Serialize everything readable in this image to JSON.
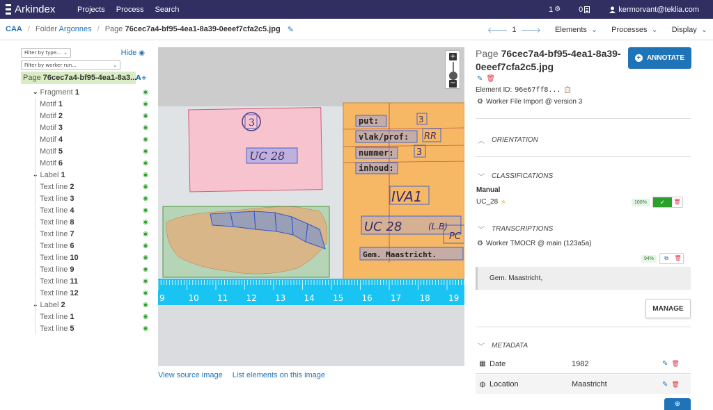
{
  "navbar": {
    "brand": "Arkindex",
    "links": [
      "Projects",
      "Process",
      "Search"
    ],
    "jobs_count": "1",
    "docs_count": "0",
    "user": "kermorvant@teklia.com"
  },
  "breadcrumb": {
    "corpus": "CAA",
    "folder_type": "Folder",
    "folder_name": "Argonnes",
    "page_type": "Page",
    "page_name": "76cec7a4-bf95-4ea1-8a39-0eeef7cfa2c5.jpg",
    "page_number": "1",
    "menus": [
      "Elements",
      "Processes",
      "Display"
    ]
  },
  "sidebar": {
    "filter_type": "Filter by type...",
    "filter_worker": "Filter by worker run...",
    "hide_label": "Hide",
    "add_label": "A+",
    "root_type": "Page",
    "root_name": "76cec7a4-bf95-4ea1-8a3...",
    "tree": [
      {
        "type": "Fragment",
        "name": "1",
        "level": 1,
        "expandable": true
      },
      {
        "type": "Motif",
        "name": "1",
        "level": 2
      },
      {
        "type": "Motif",
        "name": "2",
        "level": 2
      },
      {
        "type": "Motif",
        "name": "3",
        "level": 2
      },
      {
        "type": "Motif",
        "name": "4",
        "level": 2
      },
      {
        "type": "Motif",
        "name": "5",
        "level": 2
      },
      {
        "type": "Motif",
        "name": "6",
        "level": 2
      },
      {
        "type": "Label",
        "name": "1",
        "level": 1,
        "expandable": true
      },
      {
        "type": "Text line",
        "name": "2",
        "level": 2
      },
      {
        "type": "Text line",
        "name": "3",
        "level": 2
      },
      {
        "type": "Text line",
        "name": "4",
        "level": 2
      },
      {
        "type": "Text line",
        "name": "8",
        "level": 2
      },
      {
        "type": "Text line",
        "name": "7",
        "level": 2
      },
      {
        "type": "Text line",
        "name": "6",
        "level": 2
      },
      {
        "type": "Text line",
        "name": "10",
        "level": 2
      },
      {
        "type": "Text line",
        "name": "9",
        "level": 2
      },
      {
        "type": "Text line",
        "name": "11",
        "level": 2
      },
      {
        "type": "Text line",
        "name": "12",
        "level": 2
      },
      {
        "type": "Label",
        "name": "2",
        "level": 1,
        "expandable": true
      },
      {
        "type": "Text line",
        "name": "1",
        "level": 2
      },
      {
        "type": "Text line",
        "name": "5",
        "level": 2
      }
    ]
  },
  "image": {
    "label_left_number": "3",
    "label_left_text": "UC 28",
    "label_right_lines": [
      "put:",
      "vlak/prof:",
      "nummer:",
      "inhoud:"
    ],
    "label_right_values": [
      "3",
      "RR",
      "3",
      "IVA1",
      "UC 28",
      "(L.B)",
      "PC",
      "Gem. Maastricht."
    ],
    "ruler_numbers": [
      "9",
      "10",
      "11",
      "12",
      "13",
      "14",
      "15",
      "16",
      "17",
      "18",
      "19"
    ]
  },
  "image_links": {
    "source": "View source image",
    "list": "List elements on this image"
  },
  "panel": {
    "title_type": "Page",
    "title_name": "76cec7a4-bf95-4ea1-8a39-0eeef7cfa2c5.jpg",
    "element_id_label": "Element ID:",
    "element_id": "96e67ff8...",
    "worker": "Worker File Import @ version 3",
    "annotate_label": "ANNOTATE",
    "orientation_label": "ORIENTATION",
    "classifications_label": "CLASSIFICATIONS",
    "classification_source": "Manual",
    "classification_name": "UC_28",
    "classification_confidence": "100%",
    "transcriptions_label": "TRANSCRIPTIONS",
    "transcription_worker": "Worker TMOCR @ main (123a5a)",
    "transcription_confidence": "94%",
    "transcription_text": "Gem. Maastricht,",
    "manage_label": "MANAGE",
    "metadata_label": "METADATA",
    "metadata": [
      {
        "name": "Date",
        "value": "1982",
        "icon": "calendar-icon"
      },
      {
        "name": "Location",
        "value": "Maastricht",
        "icon": "globe-icon"
      }
    ]
  },
  "colors": {
    "navbar": "#312e62",
    "primary": "#1f73b7",
    "success": "#2ca02c",
    "danger": "#dc3545"
  }
}
